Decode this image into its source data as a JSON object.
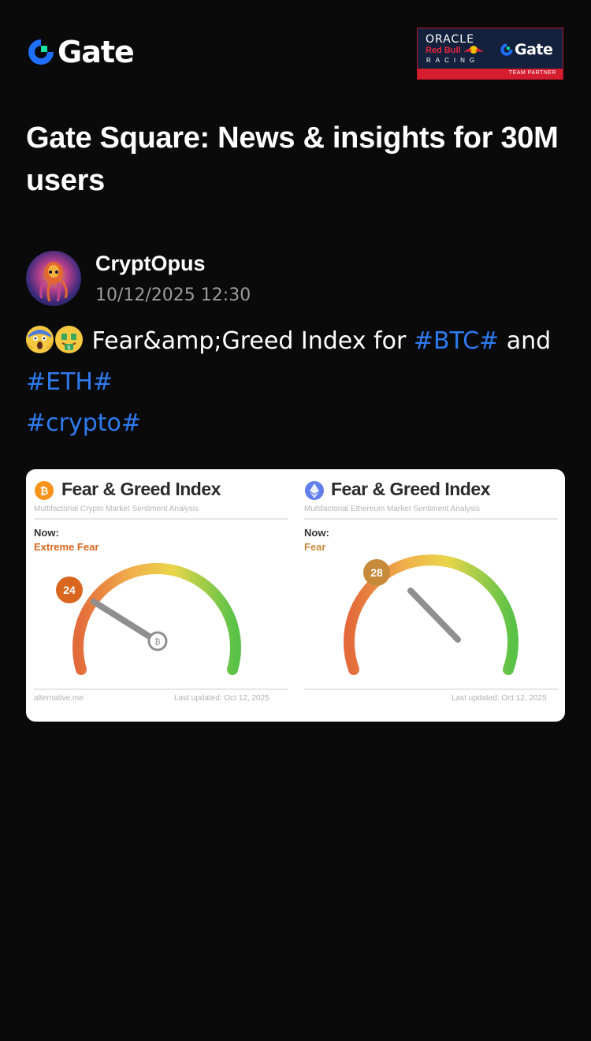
{
  "header": {
    "logo_text": "Gate",
    "partner": {
      "oracle": "ORACLE",
      "redbull": "Red Bull",
      "racing": "RACING",
      "gate": "Gate",
      "strip": "TEAM PARTNER"
    }
  },
  "title": "Gate Square: News & insights for 30M users",
  "post": {
    "author": "CryptOpus",
    "timestamp": "10/12/2025 12:30",
    "body": {
      "text_1": "Fear&amp;Greed Index for ",
      "tag_btc": "#BTC#",
      "text_2": " and",
      "tag_eth": "#ETH#",
      "tag_crypto": "#crypto#"
    },
    "image": {
      "btc": {
        "title": "Fear & Greed Index",
        "subtitle": "Multifactorial Crypto Market Sentiment Analysis",
        "now_label": "Now:",
        "status": "Extreme Fear",
        "value": "24",
        "value_num": 24,
        "source": "alternative.me",
        "updated": "Last updated: Oct 12, 2025"
      },
      "eth": {
        "title": "Fear & Greed Index",
        "subtitle": "Multifactorial Ethereum Market Sentiment Analysis",
        "now_label": "Now:",
        "status": "Fear",
        "value": "28",
        "value_num": 28,
        "updated": "Last updated: Oct 12, 2025"
      }
    }
  },
  "colors": {
    "background": "#0a0a0a",
    "accent_blue": "#2e7bf0",
    "gate_green": "#17e2a8",
    "timestamp_gray": "#9b9b9b",
    "extreme_fear": "#d9661f",
    "fear": "#c78a3a",
    "btc_coin": "#f7931a",
    "eth_coin": "#627eea"
  }
}
